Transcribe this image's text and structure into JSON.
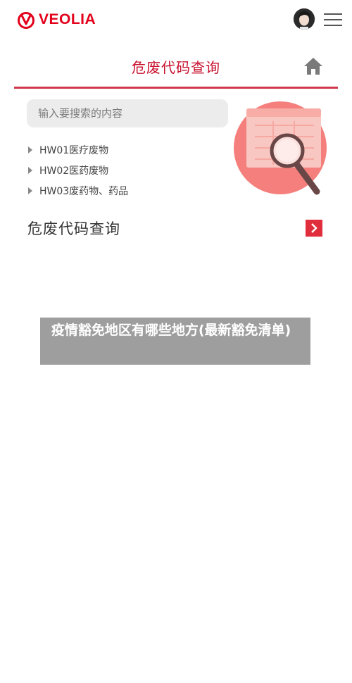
{
  "header": {
    "brand": "VEOLIA",
    "colors": {
      "brand_red": "#e2001a",
      "accent_red": "#d0394b"
    }
  },
  "page": {
    "title": "危废代码查询"
  },
  "search": {
    "placeholder": "输入要搜索的内容"
  },
  "categories": [
    {
      "label": "HW01医疗废物"
    },
    {
      "label": "HW02医药废物"
    },
    {
      "label": "HW03废药物、药品"
    }
  ],
  "section": {
    "title": "危废代码查询"
  },
  "overlay": {
    "text": "疫情豁免地区有哪些地方(最新豁免清单)"
  },
  "icons": [
    "veolia-logo-icon",
    "avatar",
    "menu-icon",
    "home-icon",
    "search-illustration-icon",
    "chevron-right-icon"
  ]
}
